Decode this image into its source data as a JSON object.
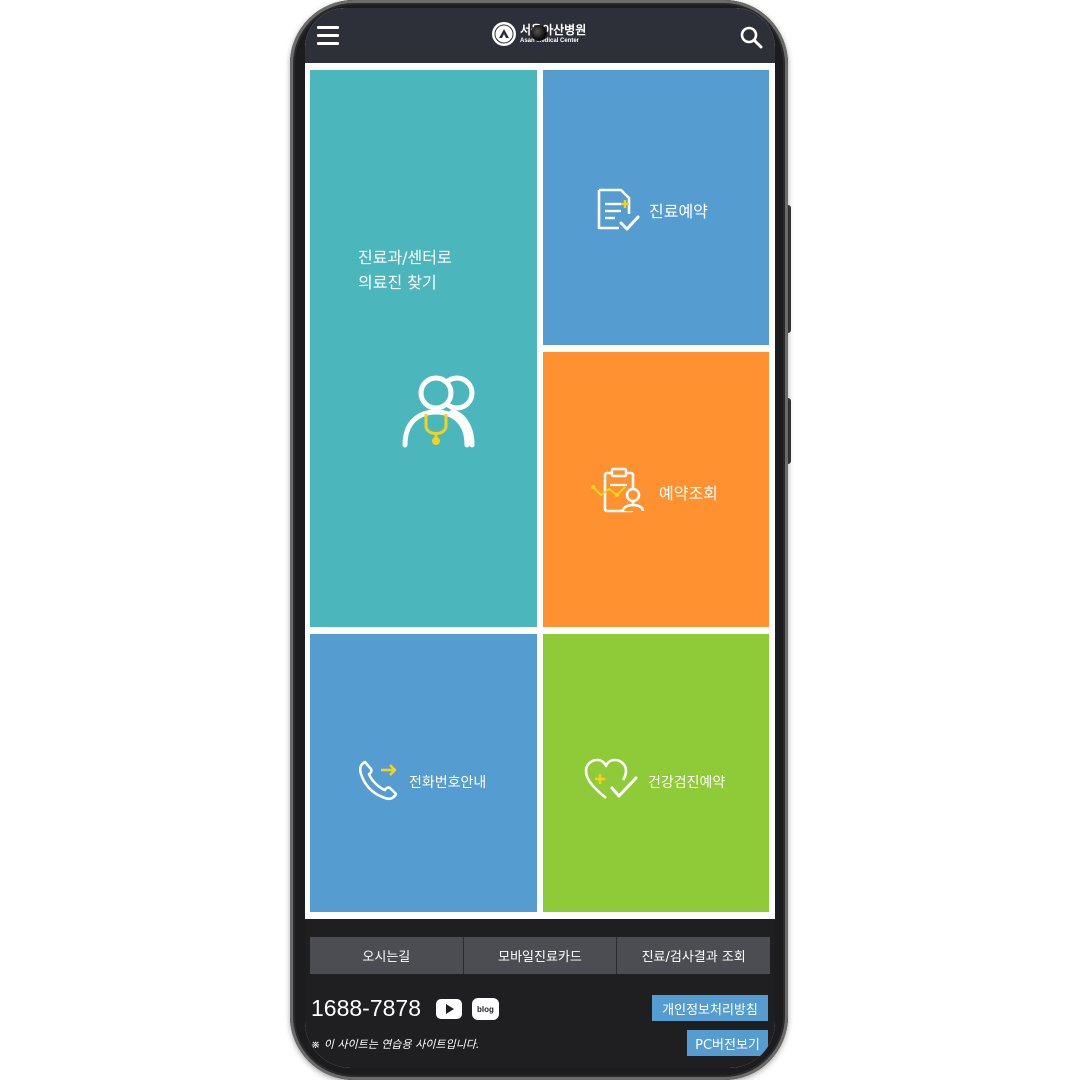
{
  "header": {
    "logo_ko": "서울아산병원",
    "logo_en": "Asan Medical Center",
    "icons": {
      "menu": "hamburger-menu-icon",
      "search": "search-icon"
    }
  },
  "tiles": {
    "find_doctor": {
      "line1": "진료과/센터로",
      "line2": "의료진 찾기",
      "icon": "doctor-group-icon",
      "color": "#4bb7bc"
    },
    "reservation": {
      "label": "진료예약",
      "icon": "clipboard-check-icon",
      "color": "#559cd0"
    },
    "reservation_lookup": {
      "label": "예약조회",
      "icon": "clipboard-person-icon",
      "color": "#ff9130"
    },
    "phone_directory": {
      "label": "전화번호안내",
      "icon": "phone-arrow-icon",
      "color": "#559cd0"
    },
    "health_checkup": {
      "label": "건강검진예약",
      "icon": "heart-check-icon",
      "color": "#8fca38"
    }
  },
  "footer": {
    "quick_links": [
      "오시는길",
      "모바일진료카드",
      "진료/검사결과 조회"
    ],
    "phone": "1688-7878",
    "blog": "blog",
    "privacy": "개인정보처리방침",
    "pc_version": "PC버전보기",
    "notice": "※ 이 사이트는 연습용 사이트입니다.",
    "accent_color": "#559cd0"
  }
}
